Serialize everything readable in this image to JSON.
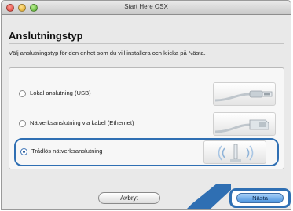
{
  "window": {
    "title": "Start Here OSX"
  },
  "page": {
    "heading": "Anslutningstyp",
    "instruction": "Välj anslutningstyp för den enhet som du vill installera och klicka på Nästa."
  },
  "options": [
    {
      "label": "Lokal anslutning (USB)",
      "icon": "usb-cable-icon",
      "selected": false
    },
    {
      "label": "Nätverksanslutning via kabel (Ethernet)",
      "icon": "ethernet-cable-icon",
      "selected": false
    },
    {
      "label": "Trådlös nätverksanslutning",
      "icon": "wireless-antenna-icon",
      "selected": true
    }
  ],
  "buttons": {
    "cancel": "Avbryt",
    "next": "Nästa"
  },
  "colors": {
    "highlight": "#2f6fb3",
    "default_button": "#4b94df"
  }
}
